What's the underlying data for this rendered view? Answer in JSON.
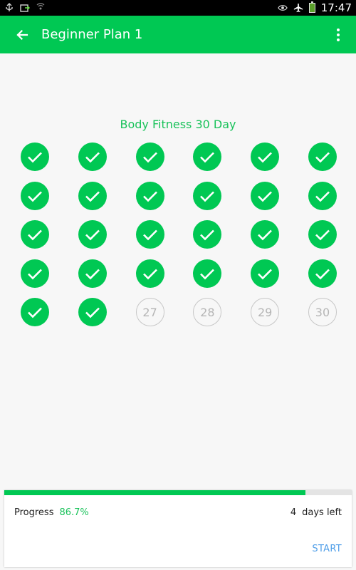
{
  "status_bar": {
    "time": "17:47",
    "left_icons": [
      "usb-icon",
      "screen-share-icon",
      "wifi-scan-icon"
    ],
    "right_icons": [
      "eye-icon",
      "airplane-icon",
      "battery-icon"
    ]
  },
  "app_bar": {
    "title": "Beginner Plan 1",
    "back_icon": "arrow-left-icon",
    "menu_icon": "more-vertical-icon",
    "color": "#00c853"
  },
  "plan": {
    "title": "Body Fitness 30 Day",
    "days": [
      {
        "day": "1",
        "done": true
      },
      {
        "day": "2",
        "done": true
      },
      {
        "day": "3",
        "done": true
      },
      {
        "day": "4",
        "done": true
      },
      {
        "day": "5",
        "done": true
      },
      {
        "day": "6",
        "done": true
      },
      {
        "day": "7",
        "done": true
      },
      {
        "day": "8",
        "done": true
      },
      {
        "day": "9",
        "done": true
      },
      {
        "day": "10",
        "done": true
      },
      {
        "day": "11",
        "done": true
      },
      {
        "day": "12",
        "done": true
      },
      {
        "day": "13",
        "done": true
      },
      {
        "day": "14",
        "done": true
      },
      {
        "day": "15",
        "done": true
      },
      {
        "day": "16",
        "done": true
      },
      {
        "day": "17",
        "done": true
      },
      {
        "day": "18",
        "done": true
      },
      {
        "day": "19",
        "done": true
      },
      {
        "day": "20",
        "done": true
      },
      {
        "day": "21",
        "done": true
      },
      {
        "day": "22",
        "done": true
      },
      {
        "day": "23",
        "done": true
      },
      {
        "day": "24",
        "done": true
      },
      {
        "day": "25",
        "done": true
      },
      {
        "day": "26",
        "done": true
      },
      {
        "day": "27",
        "done": false
      },
      {
        "day": "28",
        "done": false
      },
      {
        "day": "29",
        "done": false
      },
      {
        "day": "30",
        "done": false
      }
    ],
    "done_icon": "check-icon"
  },
  "progress": {
    "label": "Progress",
    "value_text": "86.7%",
    "fraction": 0.867,
    "days_left_count": "4",
    "days_left_label": "days left",
    "start_label": "START"
  }
}
